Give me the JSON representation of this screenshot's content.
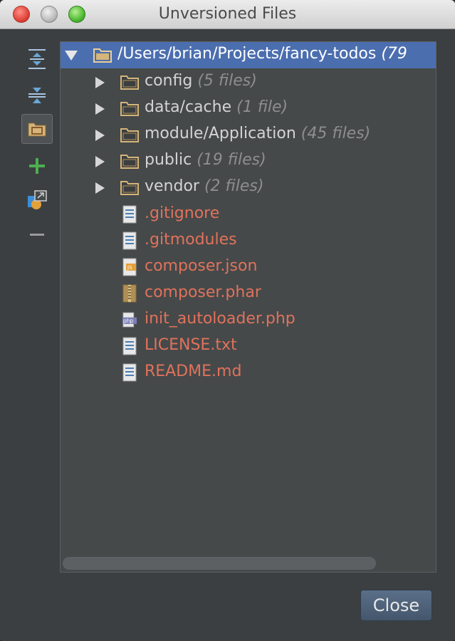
{
  "window": {
    "title": "Unversioned Files",
    "close_button_label": "Close"
  },
  "toolbar": {
    "buttons": [
      {
        "icon": "expand-all-icon"
      },
      {
        "icon": "collapse-all-icon"
      },
      {
        "icon": "group-by-directory-icon",
        "active": true
      },
      {
        "icon": "add-to-vcs-icon"
      },
      {
        "icon": "move-to-changelist-icon"
      },
      {
        "icon": "remove-icon"
      }
    ]
  },
  "tree": {
    "root": {
      "label": "/Users/brian/Projects/fancy-todos",
      "count": "(79"
    },
    "folders": [
      {
        "name": "config",
        "count": "(5 files)"
      },
      {
        "name": "data/cache",
        "count": "(1 file)"
      },
      {
        "name": "module/Application",
        "count": "(45 files)"
      },
      {
        "name": "public",
        "count": "(19 files)"
      },
      {
        "name": "vendor",
        "count": "(2 files)"
      }
    ],
    "files": [
      {
        "name": ".gitignore",
        "type": "text"
      },
      {
        "name": ".gitmodules",
        "type": "text"
      },
      {
        "name": "composer.json",
        "type": "json"
      },
      {
        "name": "composer.phar",
        "type": "archive"
      },
      {
        "name": "init_autoloader.php",
        "type": "php"
      },
      {
        "name": "LICENSE.txt",
        "type": "text"
      },
      {
        "name": "README.md",
        "type": "text"
      }
    ]
  },
  "colors": {
    "selection": "#4b6eaf",
    "unversioned_file": "#e1725b",
    "folder": "#d5b57a",
    "panel": "#45494a",
    "window": "#3c3f41"
  }
}
